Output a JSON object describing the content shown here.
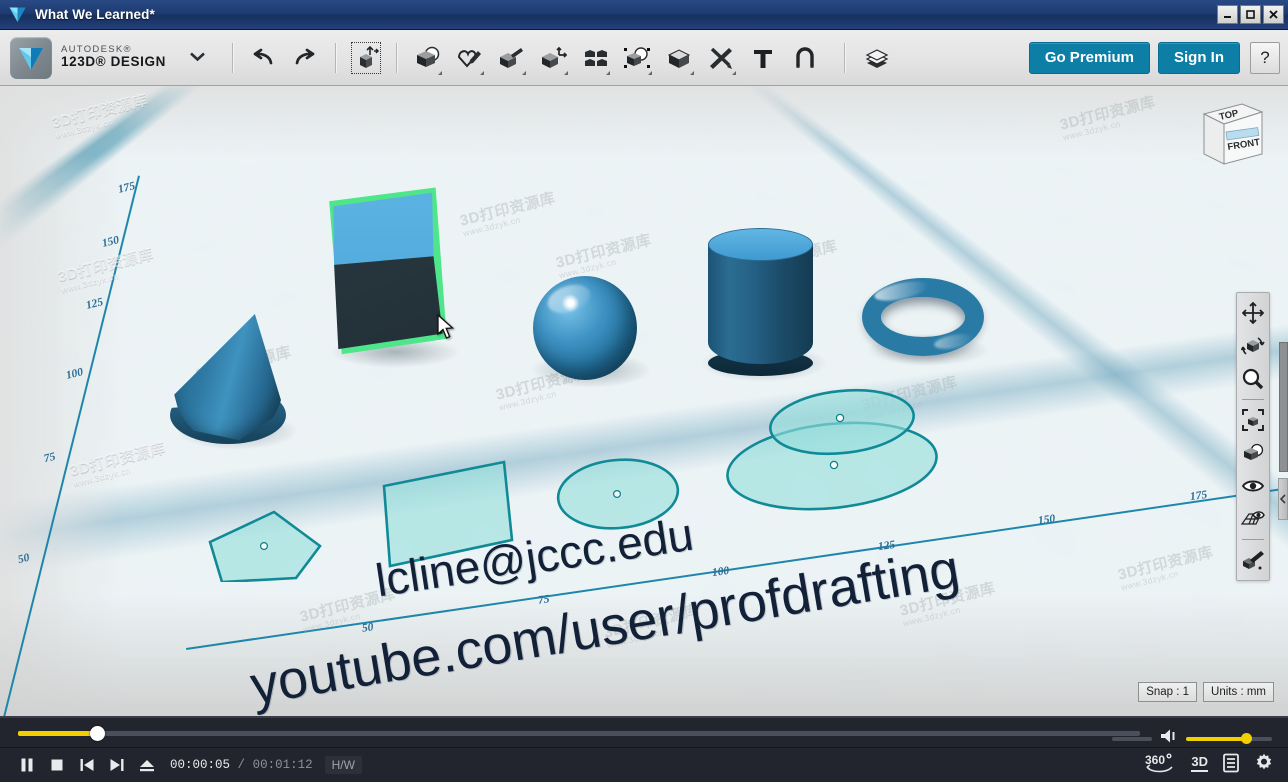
{
  "window": {
    "title": "What We Learned*",
    "app_icon": "autodesk-triangle-icon",
    "controls": {
      "minimize": "_",
      "maximize": "□",
      "close": "✕"
    }
  },
  "ribbon": {
    "brand": {
      "line1": "AUTODESK®",
      "line2": "123D® DESIGN",
      "caret": "chevron-down-icon"
    },
    "history": [
      {
        "name": "undo-button",
        "icon": "undo-arrow-icon",
        "label": "Undo"
      },
      {
        "name": "redo-button",
        "icon": "redo-arrow-icon",
        "label": "Redo"
      }
    ],
    "tools": [
      {
        "name": "transform-tool",
        "icon": "cube-move-icon",
        "label": "Transform",
        "selected": true,
        "has_dropdown": false
      },
      {
        "name": "primitives-tool",
        "icon": "cube-sphere-icon",
        "label": "Primitives",
        "has_dropdown": true
      },
      {
        "name": "sketch-tool",
        "icon": "pencil-shape-icon",
        "label": "Sketch",
        "has_dropdown": true
      },
      {
        "name": "construct-tool",
        "icon": "extrude-cube-icon",
        "label": "Construct",
        "has_dropdown": true
      },
      {
        "name": "modify-tool",
        "icon": "cube-arrows-icon",
        "label": "Modify",
        "has_dropdown": true
      },
      {
        "name": "pattern-tool",
        "icon": "four-cubes-icon",
        "label": "Pattern",
        "has_dropdown": true
      },
      {
        "name": "grouping-tool",
        "icon": "cube-select-icon",
        "label": "Grouping",
        "has_dropdown": true
      },
      {
        "name": "combine-tool",
        "icon": "cube-combine-icon",
        "label": "Combine",
        "has_dropdown": true
      },
      {
        "name": "measure-tool",
        "icon": "ruler-pencil-icon",
        "label": "Measure",
        "has_dropdown": true
      },
      {
        "name": "text-tool",
        "icon": "text-t-icon",
        "label": "Text",
        "has_dropdown": false
      },
      {
        "name": "snap-tool",
        "icon": "magnet-icon",
        "label": "Snap",
        "has_dropdown": false
      },
      {
        "name": "materials-tool",
        "icon": "layers-stack-icon",
        "label": "Materials",
        "has_dropdown": false
      }
    ],
    "go_premium": "Go Premium",
    "sign_in": "Sign In",
    "help": "?",
    "accent": "#0d7ea6"
  },
  "viewport": {
    "viewcube": {
      "top_face": "TOP",
      "front_face": "FRONT"
    },
    "ruler_left": [
      "175",
      "150",
      "125",
      "100",
      "75",
      "50"
    ],
    "ruler_bottom": [
      "50",
      "75",
      "100",
      "125",
      "150",
      "175"
    ],
    "nav_tools": [
      {
        "name": "pan-button",
        "icon": "four-way-arrows-icon"
      },
      {
        "name": "orbit-button",
        "icon": "orbit-cube-icon"
      },
      {
        "name": "zoom-button",
        "icon": "magnifier-icon"
      },
      {
        "name": "fit-view-button",
        "icon": "fit-to-view-icon"
      },
      {
        "name": "visual-style-button",
        "icon": "cube-sphere-icon"
      },
      {
        "name": "visibility-button",
        "icon": "eye-icon"
      },
      {
        "name": "grid-settings-button",
        "icon": "grid-eye-icon"
      },
      {
        "name": "material-paint-button",
        "icon": "cube-brush-icon"
      }
    ],
    "chips": [
      {
        "name": "snap-chip",
        "label": "Snap : 1"
      },
      {
        "name": "units-chip",
        "label": "Units : mm"
      }
    ],
    "annotations": [
      {
        "name": "email-text",
        "text": "lcline@jccc.edu"
      },
      {
        "name": "youtube-url-text",
        "text": "youtube.com/user/profdrafting"
      }
    ],
    "solids": [
      {
        "name": "cone-solid",
        "shape": "cone",
        "color": "#2f7ba6",
        "selected": false
      },
      {
        "name": "box-solid",
        "shape": "box",
        "color": "#4aa4da",
        "selected": true,
        "highlight": "#4fe58a"
      },
      {
        "name": "sphere-solid",
        "shape": "sphere",
        "color": "#3f93c4",
        "selected": false
      },
      {
        "name": "cylinder-solid",
        "shape": "cylinder",
        "color": "#2b6d92",
        "selected": false
      },
      {
        "name": "torus-solid",
        "shape": "torus",
        "color": "#2a7aa6",
        "selected": false
      }
    ],
    "sketches": [
      {
        "name": "pentagon-sketch",
        "shape": "pentagon"
      },
      {
        "name": "rectangle-sketch",
        "shape": "rectangle"
      },
      {
        "name": "circle-sketch",
        "shape": "circle"
      },
      {
        "name": "ellipse-sketch-upper",
        "shape": "ellipse"
      },
      {
        "name": "ellipse-sketch-lower",
        "shape": "ellipse"
      }
    ],
    "watermarks": [
      "3D打印资源库",
      "www.3dzyk.cn"
    ],
    "grid_color": "#1880a0",
    "plane_color": "#eef4f6"
  },
  "player": {
    "elapsed": "00:00:05",
    "separator": "/",
    "total": "00:01:12",
    "hw_badge": "H/W",
    "progress_percent": 7,
    "volume_percent": 70,
    "accent": "#f2d000",
    "controls": [
      {
        "name": "pause-button",
        "icon": "pause-icon"
      },
      {
        "name": "stop-button",
        "icon": "stop-icon"
      },
      {
        "name": "previous-button",
        "icon": "previous-track-icon"
      },
      {
        "name": "next-button",
        "icon": "next-track-icon"
      },
      {
        "name": "eject-button",
        "icon": "eject-icon"
      }
    ],
    "right_controls": [
      {
        "name": "threesixty-button",
        "label": "360°",
        "icon": "rotate-360-icon"
      },
      {
        "name": "threed-button",
        "label": "3D",
        "icon": "three-d-icon"
      },
      {
        "name": "playlist-button",
        "label": "",
        "icon": "playlist-icon"
      },
      {
        "name": "settings-button",
        "label": "",
        "icon": "gear-icon"
      }
    ]
  }
}
